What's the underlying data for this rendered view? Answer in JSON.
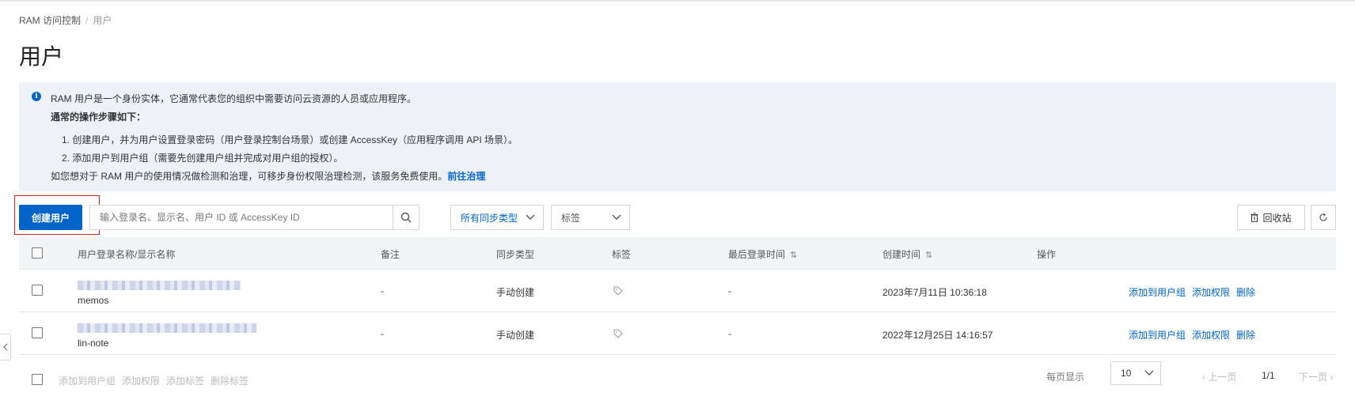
{
  "breadcrumb": {
    "root": "RAM 访问控制",
    "current": "用户"
  },
  "page_title": "用户",
  "notice": {
    "intro": "RAM 用户是一个身份实体，它通常代表您的组织中需要访问云资源的人员或应用程序。",
    "steps_title": "通常的操作步骤如下：",
    "step1": "1. 创建用户，并为用户设置登录密码（用户登录控制台场景）或创建 AccessKey（应用程序调用 API 场景）。",
    "step2": "2. 添加用户到用户组（需要先创建用户组并完成对用户组的授权）。",
    "footer_text": "如您想对于 RAM 用户的使用情况做检测和治理，可移步身份权限治理检测，该服务免费使用。",
    "footer_link": "前往治理"
  },
  "toolbar": {
    "create_label": "创建用户",
    "search_placeholder": "输入登录名、显示名、用户 ID 或 AccessKey ID",
    "sync_type": "所有同步类型",
    "tag": "标签",
    "recycle_label": "回收站"
  },
  "table": {
    "headers": {
      "name": "用户登录名称/显示名称",
      "remark": "备注",
      "sync": "同步类型",
      "tag": "标签",
      "last_login": "最后登录时间",
      "created": "创建时间",
      "ops": "操作"
    },
    "rows": [
      {
        "display_name": "memos",
        "remark": "-",
        "sync": "手动创建",
        "last_login": "-",
        "created": "2023年7月11日 10:36:18"
      },
      {
        "display_name": "lin-note",
        "remark": "-",
        "sync": "手动创建",
        "last_login": "-",
        "created": "2022年12月25日 14:16:57"
      }
    ],
    "ops": {
      "add_group": "添加到用户组",
      "add_perm": "添加权限",
      "delete": "删除"
    }
  },
  "footer": {
    "batch": {
      "add_group": "添加到用户组",
      "add_perm": "添加权限",
      "add_tag": "添加标签",
      "del_tag": "删除标签"
    },
    "per_page_label": "每页显示",
    "per_page": "10",
    "prev": "上一页",
    "page": "1/1",
    "next": "下一页"
  },
  "colors": {
    "primary": "#0064c8",
    "notice_bg": "#eef1f6",
    "highlight_border": "#e02020"
  }
}
